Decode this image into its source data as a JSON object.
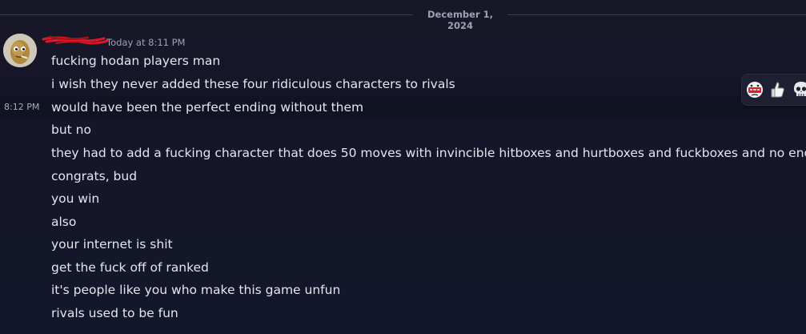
{
  "date_divider": "December 1, 2024",
  "message_group": {
    "username": "",
    "timestamp": "Today at 8:11 PM",
    "hover_timestamp": "8:12 PM",
    "messages": [
      "fucking hodan players man",
      "i wish they never added these four ridiculous characters to rivals",
      "would have been the perfect ending without them",
      "but no",
      "they had to add a fucking character that does 50 moves with invincible hitboxes and hurtboxes and fuckboxes and no endlag",
      "congrats, bud",
      "you win",
      "also",
      "your internet is shit",
      "get the fuck off of ranked",
      "it's people like you who make this game unfun",
      "rivals used to be fun"
    ]
  },
  "reaction_bar": {
    "buttons": [
      {
        "icon": "hmm-reaction-icon"
      },
      {
        "icon": "thumbs-up-reaction-icon"
      },
      {
        "icon": "skull-reaction-icon"
      }
    ]
  },
  "colors": {
    "background": "#171727",
    "hover_row": "#101322",
    "text": "#e4e6ef",
    "muted": "#9ea2b4",
    "redaction": "#e0182a"
  }
}
